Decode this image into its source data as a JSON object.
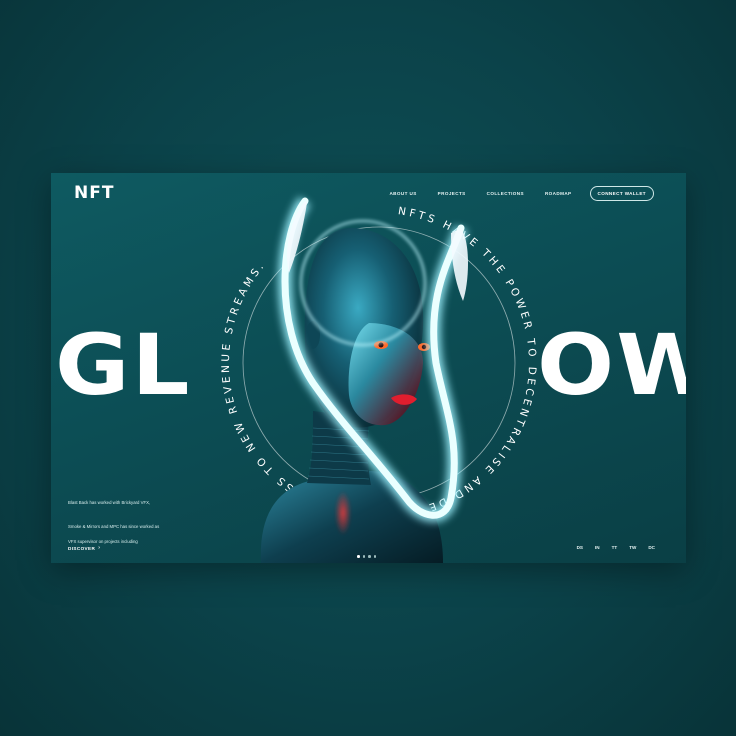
{
  "brand": {
    "logo": "NFT"
  },
  "nav": {
    "items": [
      "ABOUT US",
      "PROJECTS",
      "COLLECTIONS",
      "ROADMAP"
    ],
    "connect_label": "CONNECT WALLET"
  },
  "hero": {
    "word_left": "GL",
    "word_right": "OW",
    "circle_text": "NFTS HAVE THE POWER TO DECENTRALISE AND DEMOCRATISE ACCESS TO NEW REVENUE STREAMS."
  },
  "description": {
    "lines": [
      "Blast Back has worked with Brickyard VFX,",
      "Smoke & Mirrors and MPC has since worked as",
      "VFX supervisor on projects including"
    ],
    "discover_label": "DISCOVER",
    "discover_icon": "arrow-right-icon"
  },
  "slider": {
    "count": 4,
    "active_index": 0
  },
  "socials": [
    "DS",
    "IN",
    "TT",
    "TW",
    "DC"
  ],
  "colors": {
    "page_bg": "#0b3f45",
    "panel_bg": "#0c4c53",
    "accent_glow": "#bff7ff",
    "text": "#ffffff"
  }
}
